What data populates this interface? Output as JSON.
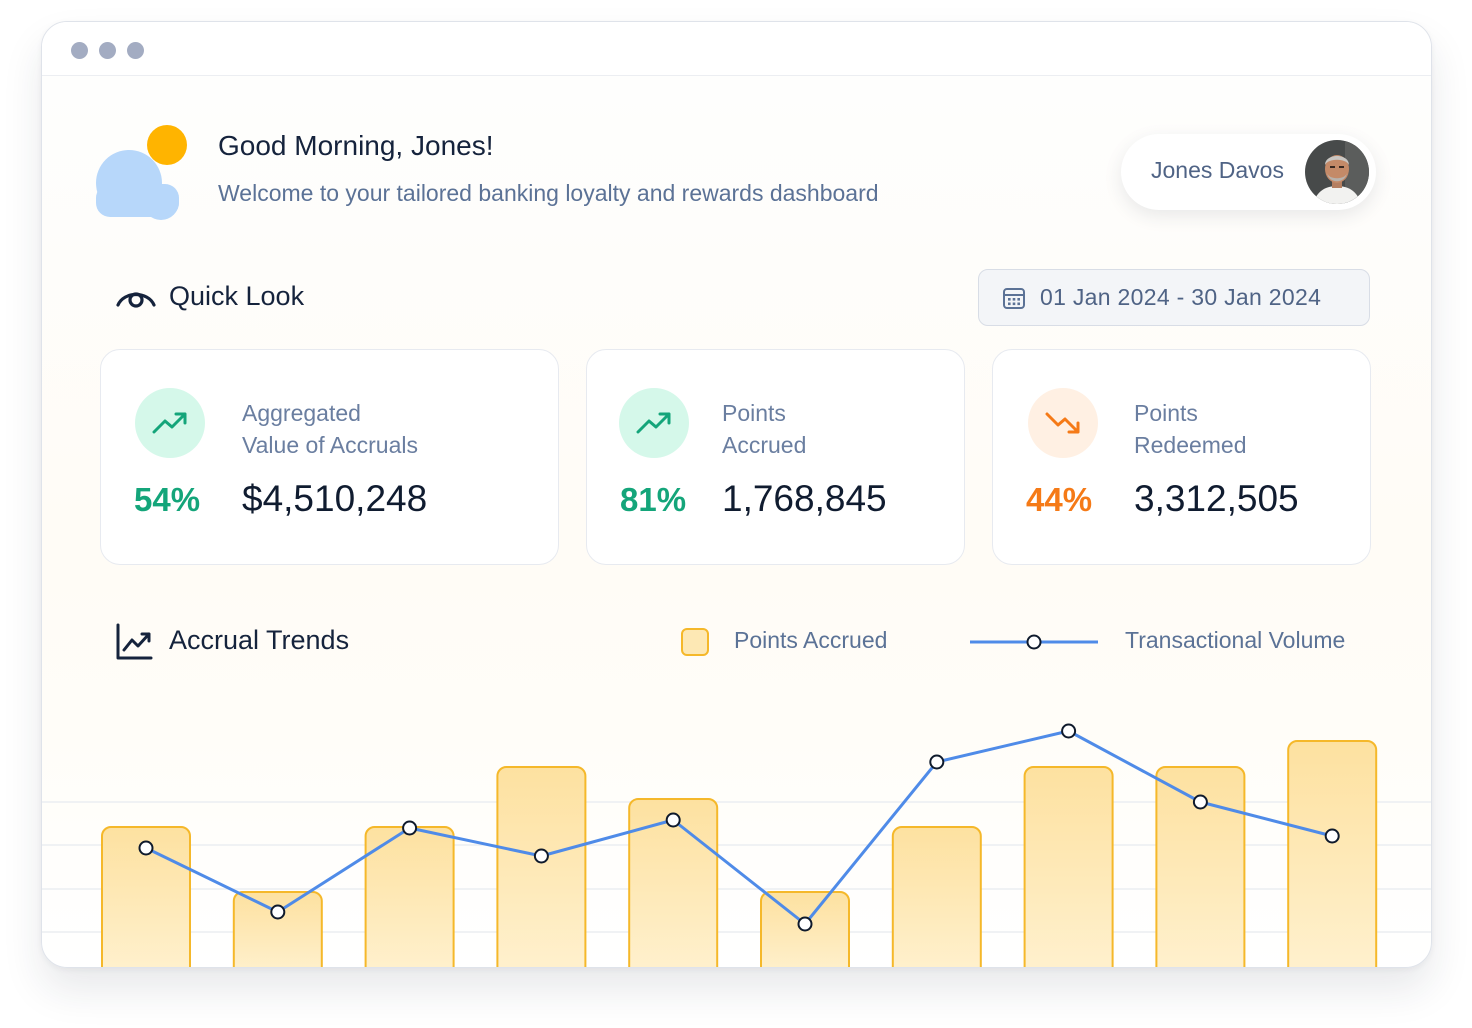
{
  "greeting": {
    "title": "Good Morning, Jones!",
    "subtitle": "Welcome to your tailored banking loyalty and rewards dashboard"
  },
  "user": {
    "name": "Jones Davos"
  },
  "quick_look": {
    "title": "Quick Look",
    "date_range": "01 Jan 2024 - 30 Jan 2024",
    "cards": [
      {
        "label_line1": "Aggregated",
        "label_line2": "Value of Accruals",
        "percent": "54%",
        "value": "$4,510,248",
        "trend": "up"
      },
      {
        "label_line1": "Points",
        "label_line2": "Accrued",
        "percent": "81%",
        "value": "1,768,845",
        "trend": "up"
      },
      {
        "label_line1": "Points",
        "label_line2": "Redeemed",
        "percent": "44%",
        "value": "3,312,505",
        "trend": "down"
      }
    ]
  },
  "accrual_trends": {
    "title": "Accrual Trends",
    "legend": {
      "bars": "Points Accrued",
      "line": "Transactional Volume"
    }
  },
  "colors": {
    "up": "#14a57a",
    "up_bg": "#d5f8ea",
    "down": "#f57a17",
    "down_bg": "#fff0e3",
    "bar_stroke": "#f5b82a",
    "line": "#4f8be8"
  },
  "chart_data": {
    "type": "bar",
    "categories": [
      "",
      "",
      "",
      "",
      "",
      "",
      "",
      "",
      "",
      ""
    ],
    "series": [
      {
        "name": "Points Accrued",
        "type": "bar",
        "values": [
          140,
          75,
          140,
          200,
          168,
          75,
          140,
          200,
          200,
          226
        ]
      },
      {
        "name": "Transactional Volume",
        "type": "line",
        "values": [
          119,
          55,
          139,
          111,
          147,
          43,
          205,
          236,
          165,
          131
        ]
      }
    ],
    "ylim": [
      0,
      260
    ],
    "grid": true,
    "legend_position": "top-right"
  }
}
